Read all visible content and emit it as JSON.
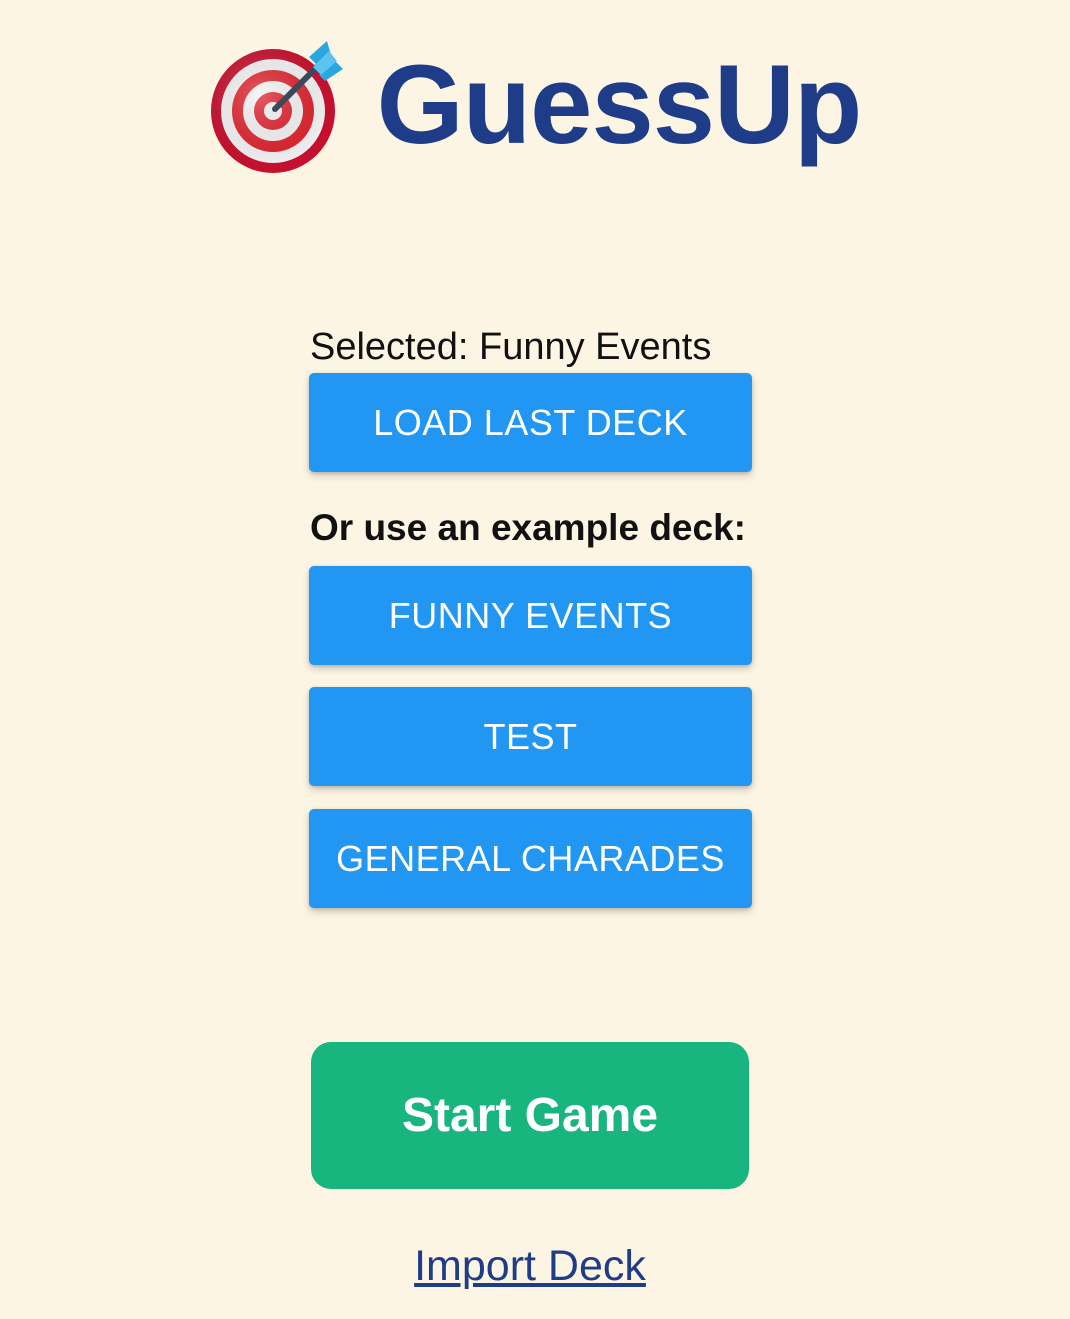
{
  "header": {
    "title": "GuessUp",
    "logo_icon": "dart-target-icon"
  },
  "deck": {
    "selected_text": "Selected: Funny Events",
    "load_last_label": "LOAD LAST DECK",
    "examples_heading": "Or use an example deck:",
    "examples": [
      {
        "label": "FUNNY EVENTS"
      },
      {
        "label": "TEST"
      },
      {
        "label": "GENERAL CHARADES"
      }
    ]
  },
  "actions": {
    "start_label": "Start Game",
    "import_label": "Import Deck"
  },
  "colors": {
    "background": "#fdf5e4",
    "title": "#1f3c88",
    "deck_button": "#2196f3",
    "start_button": "#19b57f",
    "link": "#1f3c88"
  }
}
